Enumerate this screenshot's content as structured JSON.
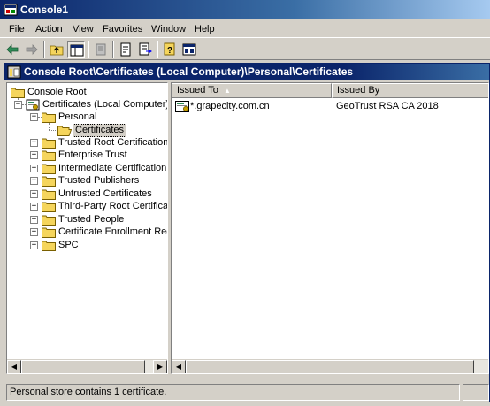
{
  "window": {
    "title": "Console1"
  },
  "menu": [
    "File",
    "Action",
    "View",
    "Favorites",
    "Window",
    "Help"
  ],
  "toolbar": [
    "back-icon",
    "forward-icon",
    "up-level-icon",
    "show-hide-tree-icon",
    "delete-icon",
    "properties-icon",
    "export-list-icon",
    "help-icon",
    "mmc-icon"
  ],
  "child_window": {
    "title": "Console Root\\Certificates (Local Computer)\\Personal\\Certificates"
  },
  "tree": {
    "root": "Console Root",
    "certificates": "Certificates (Local Computer)",
    "personal": "Personal",
    "personal_certs": "Certificates",
    "stores": [
      "Trusted Root Certification Authorities",
      "Enterprise Trust",
      "Intermediate Certification Authorities",
      "Trusted Publishers",
      "Untrusted Certificates",
      "Third-Party Root Certification Authorities",
      "Trusted People",
      "Certificate Enrollment Requests",
      "SPC"
    ]
  },
  "list": {
    "columns": [
      "Issued To",
      "Issued By"
    ],
    "rows": [
      {
        "issued_to": "*.grapecity.com.cn",
        "issued_by": "GeoTrust RSA CA 2018"
      }
    ]
  },
  "status": {
    "text": "Personal store contains 1 certificate."
  },
  "colors": {
    "title_active": "#0a246a",
    "face": "#d4d0c8",
    "folder": "#f5d55c"
  }
}
